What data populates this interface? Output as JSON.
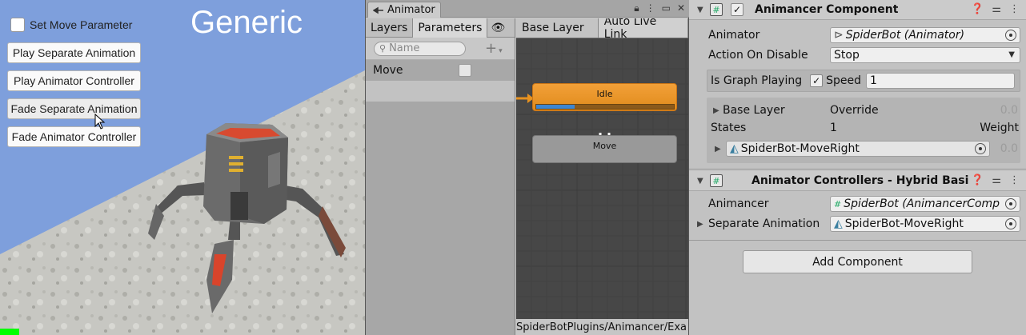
{
  "game": {
    "title": "Generic",
    "checkbox_label": "Set Move Parameter",
    "buttons": [
      "Play Separate Animation",
      "Play Animator Controller",
      "Fade Separate Animation",
      "Fade Animator Controller"
    ]
  },
  "animator": {
    "window_title": "Animator",
    "tabs": [
      "Layers",
      "Parameters"
    ],
    "search_placeholder": "Name",
    "parameters": [
      {
        "name": "Move",
        "value": false
      }
    ],
    "graph_tabs": [
      "Base Layer",
      "Auto Live Link"
    ],
    "states": {
      "idle": "Idle",
      "move": "Move"
    },
    "idle_progress": 0.28,
    "path": "SpiderBotPlugins/Animancer/Exa"
  },
  "inspector": {
    "animancer_component": {
      "title": "Animancer Component",
      "animator_label": "Animator",
      "animator_value": "SpiderBot (Animator)",
      "action_label": "Action On Disable",
      "action_value": "Stop",
      "graph_playing_label": "Is Graph Playing",
      "speed_label": "Speed",
      "speed_value": "1",
      "layer_label": "Base Layer",
      "layer_mode": "Override",
      "layer_weight": "0.0",
      "states_label": "States",
      "states_count": "1",
      "weight_label": "Weight",
      "state_name": "SpiderBot-MoveRight",
      "state_weight": "0.0"
    },
    "controllers_component": {
      "title": "Animator Controllers - Hybrid Basi",
      "animancer_label": "Animancer",
      "animancer_value": "SpiderBot (AnimancerComp",
      "separate_label": "Separate Animation",
      "separate_value": "SpiderBot-MoveRight"
    },
    "add_component": "Add Component"
  },
  "colors": {
    "idle_state": "#e8921f",
    "progress": "#3d86d1",
    "game_sky": "#7e9fdc"
  }
}
